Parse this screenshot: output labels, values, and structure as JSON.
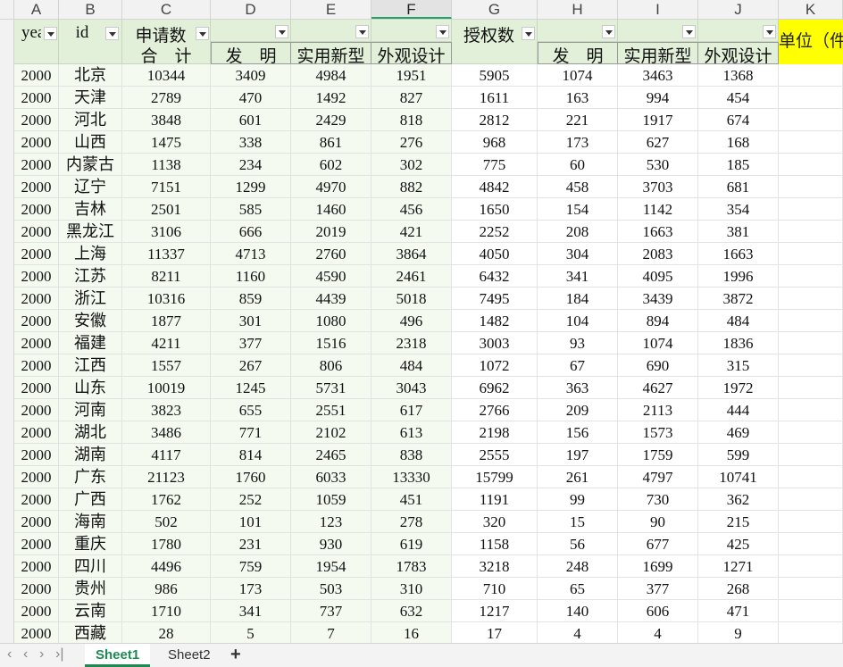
{
  "columns": [
    "A",
    "B",
    "C",
    "D",
    "E",
    "F",
    "G",
    "H",
    "I",
    "J",
    "K"
  ],
  "selected_column": "F",
  "headers": {
    "year": "year",
    "id": "id",
    "application": "申请数",
    "grant": "授权数",
    "total": "合　计",
    "invention": "发　明",
    "utility": "实用新型",
    "design": "外观设计",
    "unit": "单位（件"
  },
  "row_numbers": [
    "",
    "",
    "",
    "",
    "",
    "",
    "",
    "",
    "",
    "",
    "",
    "",
    "",
    "",
    "",
    "",
    "",
    "",
    "",
    "",
    "",
    "",
    "",
    "",
    "",
    "",
    ""
  ],
  "rows": [
    [
      "2000",
      "北京",
      "10344",
      "3409",
      "4984",
      "1951",
      "5905",
      "1074",
      "3463",
      "1368"
    ],
    [
      "2000",
      "天津",
      "2789",
      "470",
      "1492",
      "827",
      "1611",
      "163",
      "994",
      "454"
    ],
    [
      "2000",
      "河北",
      "3848",
      "601",
      "2429",
      "818",
      "2812",
      "221",
      "1917",
      "674"
    ],
    [
      "2000",
      "山西",
      "1475",
      "338",
      "861",
      "276",
      "968",
      "173",
      "627",
      "168"
    ],
    [
      "2000",
      "内蒙古",
      "1138",
      "234",
      "602",
      "302",
      "775",
      "60",
      "530",
      "185"
    ],
    [
      "2000",
      "辽宁",
      "7151",
      "1299",
      "4970",
      "882",
      "4842",
      "458",
      "3703",
      "681"
    ],
    [
      "2000",
      "吉林",
      "2501",
      "585",
      "1460",
      "456",
      "1650",
      "154",
      "1142",
      "354"
    ],
    [
      "2000",
      "黑龙江",
      "3106",
      "666",
      "2019",
      "421",
      "2252",
      "208",
      "1663",
      "381"
    ],
    [
      "2000",
      "上海",
      "11337",
      "4713",
      "2760",
      "3864",
      "4050",
      "304",
      "2083",
      "1663"
    ],
    [
      "2000",
      "江苏",
      "8211",
      "1160",
      "4590",
      "2461",
      "6432",
      "341",
      "4095",
      "1996"
    ],
    [
      "2000",
      "浙江",
      "10316",
      "859",
      "4439",
      "5018",
      "7495",
      "184",
      "3439",
      "3872"
    ],
    [
      "2000",
      "安徽",
      "1877",
      "301",
      "1080",
      "496",
      "1482",
      "104",
      "894",
      "484"
    ],
    [
      "2000",
      "福建",
      "4211",
      "377",
      "1516",
      "2318",
      "3003",
      "93",
      "1074",
      "1836"
    ],
    [
      "2000",
      "江西",
      "1557",
      "267",
      "806",
      "484",
      "1072",
      "67",
      "690",
      "315"
    ],
    [
      "2000",
      "山东",
      "10019",
      "1245",
      "5731",
      "3043",
      "6962",
      "363",
      "4627",
      "1972"
    ],
    [
      "2000",
      "河南",
      "3823",
      "655",
      "2551",
      "617",
      "2766",
      "209",
      "2113",
      "444"
    ],
    [
      "2000",
      "湖北",
      "3486",
      "771",
      "2102",
      "613",
      "2198",
      "156",
      "1573",
      "469"
    ],
    [
      "2000",
      "湖南",
      "4117",
      "814",
      "2465",
      "838",
      "2555",
      "197",
      "1759",
      "599"
    ],
    [
      "2000",
      "广东",
      "21123",
      "1760",
      "6033",
      "13330",
      "15799",
      "261",
      "4797",
      "10741"
    ],
    [
      "2000",
      "广西",
      "1762",
      "252",
      "1059",
      "451",
      "1191",
      "99",
      "730",
      "362"
    ],
    [
      "2000",
      "海南",
      "502",
      "101",
      "123",
      "278",
      "320",
      "15",
      "90",
      "215"
    ],
    [
      "2000",
      "重庆",
      "1780",
      "231",
      "930",
      "619",
      "1158",
      "56",
      "677",
      "425"
    ],
    [
      "2000",
      "四川",
      "4496",
      "759",
      "1954",
      "1783",
      "3218",
      "248",
      "1699",
      "1271"
    ],
    [
      "2000",
      "贵州",
      "986",
      "173",
      "503",
      "310",
      "710",
      "65",
      "377",
      "268"
    ],
    [
      "2000",
      "云南",
      "1710",
      "341",
      "737",
      "632",
      "1217",
      "140",
      "606",
      "471"
    ],
    [
      "2000",
      "西藏",
      "28",
      "5",
      "7",
      "16",
      "17",
      "4",
      "4",
      "9"
    ]
  ],
  "tabs": {
    "nav_first": "‹",
    "nav_prev": "‹",
    "nav_next": "›",
    "nav_last": "›|",
    "sheet1": "Sheet1",
    "sheet2": "Sheet2",
    "add": "+"
  },
  "colors": {
    "header_green": "#e2f0d9",
    "unit_yellow": "#ffff00",
    "active_tab": "#1e8a52"
  }
}
